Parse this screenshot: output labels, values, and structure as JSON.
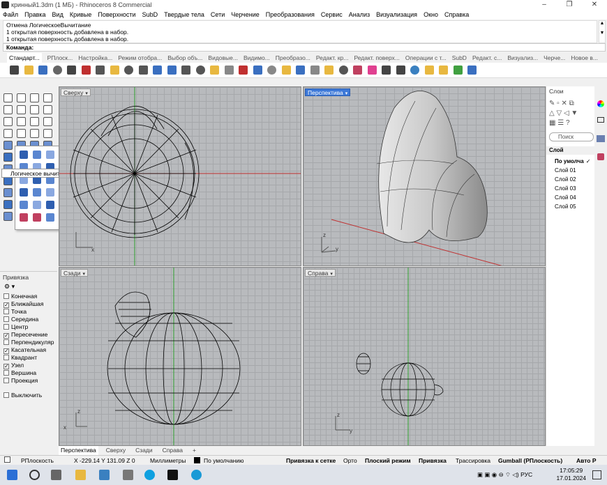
{
  "window": {
    "title": "кринный1.3dm (1 МБ) - Rhinoceros 8 Commercial"
  },
  "menu": [
    "Файл",
    "Правка",
    "Вид",
    "Кривые",
    "Поверхности",
    "SubD",
    "Твердые тела",
    "Сети",
    "Черчение",
    "Преобразования",
    "Сервис",
    "Анализ",
    "Визуализация",
    "Окно",
    "Справка"
  ],
  "command_history": [
    "Отмена ЛогическоеВычитание",
    "1 открытая поверхность добавлена в набор.",
    "1 открытая поверхность добавлена в набор."
  ],
  "command_prompt": "Команда:",
  "toolbar_tabs": [
    "Стандарт...",
    "РПлоск...",
    "Настройка...",
    "Режим отобра...",
    "Выбор объ...",
    "Видовые...",
    "Видимо...",
    "Преобразо...",
    "Редакт. кр...",
    "Редакт. поверх...",
    "Операции с т...",
    "SubD",
    "Редакт. с...",
    "Визуализ...",
    "Черче...",
    "Новое в..."
  ],
  "tooltip": "Логическое вычитание",
  "osnap": {
    "title": "Привязка",
    "items": [
      {
        "label": "Конечная",
        "checked": false
      },
      {
        "label": "Ближайшая",
        "checked": true
      },
      {
        "label": "Точка",
        "checked": false
      },
      {
        "label": "Середина",
        "checked": false
      },
      {
        "label": "Центр",
        "checked": false
      },
      {
        "label": "Пересечение",
        "checked": true
      },
      {
        "label": "Перпендикуляр",
        "checked": false
      },
      {
        "label": "Касательная",
        "checked": true
      },
      {
        "label": "Квадрант",
        "checked": false
      },
      {
        "label": "Узел",
        "checked": true
      },
      {
        "label": "Вершина",
        "checked": false
      },
      {
        "label": "Проекция",
        "checked": false
      }
    ],
    "disable": "Выключить"
  },
  "viewports": {
    "top": "Сверху",
    "perspective": "Перспектива",
    "back": "Сзади",
    "right": "Справа"
  },
  "axis": {
    "x": "x",
    "y": "y",
    "z": "z"
  },
  "viewport_tabs": [
    "Перспектива",
    "Сверху",
    "Сзади",
    "Справа"
  ],
  "layers": {
    "title": "Слои",
    "search_placeholder": "Поиск",
    "column": "Слой",
    "rows": [
      "По умолча",
      "Слой 01",
      "Слой 02",
      "Слой 03",
      "Слой 04",
      "Слой 05"
    ],
    "current_mark": "✓"
  },
  "status": {
    "cplane": "РПлоскость",
    "coords": "X -229.14 Y 131.09 Z 0",
    "units": "Миллиметры",
    "layer": "По умолчанию",
    "toggles": [
      "Привязка к сетке",
      "Орто",
      "Плоский режим",
      "Привязка",
      "Трассировка",
      "Gumball (РПлоскость)",
      "Авто Р"
    ]
  },
  "taskbar": {
    "time": "17:05:29",
    "date": "17.01.2024",
    "lang": "РУС"
  }
}
